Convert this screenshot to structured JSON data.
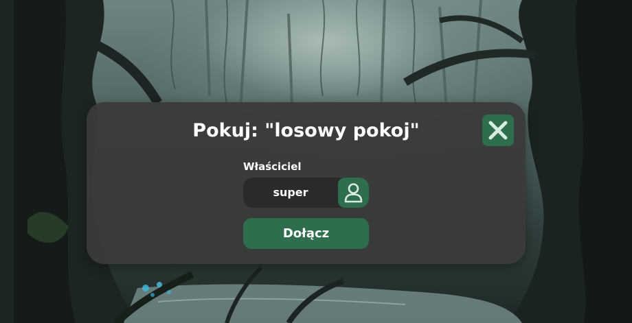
{
  "modal": {
    "title": "Pokuj: \"losowy pokoj\"",
    "close_icon": "close-x-icon",
    "owner_label": "Właściciel",
    "owner_name": "super",
    "owner_icon": "user-icon",
    "join_label": "Dołącz"
  },
  "colors": {
    "modal_background": "#3a3a3a",
    "accent_green": "#2f6e4d",
    "field_background": "#2a2a2a",
    "text": "#ffffff"
  }
}
